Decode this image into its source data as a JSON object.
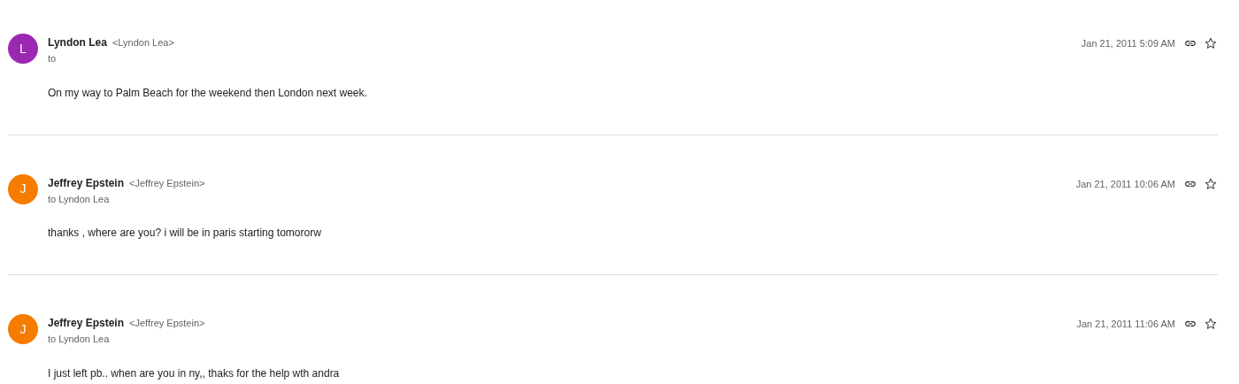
{
  "messages": [
    {
      "initial": "L",
      "color": "#9c27b0",
      "sender": "Lyndon Lea",
      "address": "<Lyndon Lea>",
      "recipients": "to",
      "date": "Jan 21, 2011 5:09 AM",
      "starred": false,
      "body": "On my way to Palm Beach for the weekend then London next week."
    },
    {
      "initial": "J",
      "color": "#f57c00",
      "sender": "Jeffrey Epstein",
      "address": "<Jeffrey Epstein>",
      "recipients": "to Lyndon Lea",
      "date": "Jan 21, 2011 10:06 AM",
      "starred": false,
      "body": "thanks , where are you? i will be in paris starting tomororw"
    },
    {
      "initial": "J",
      "color": "#f57c00",
      "sender": "Jeffrey Epstein",
      "address": "<Jeffrey Epstein>",
      "recipients": "to Lyndon Lea",
      "date": "Jan 21, 2011 11:06 AM",
      "starred": false,
      "body": "I just left pb.. when are you in ny,, thaks for the help wth andra"
    }
  ]
}
